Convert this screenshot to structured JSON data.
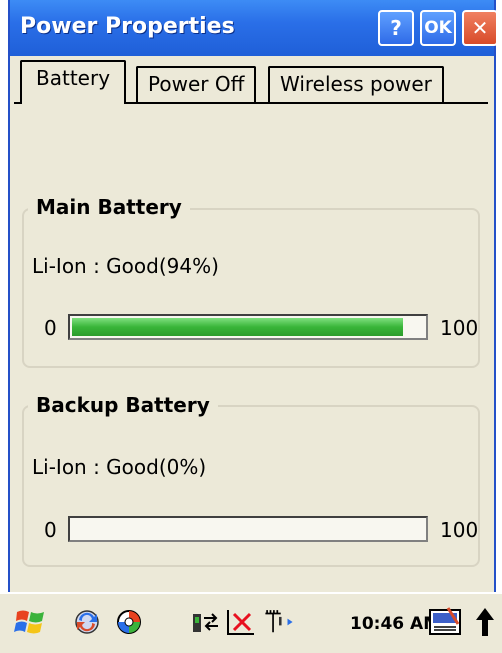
{
  "window": {
    "title": "Power Properties"
  },
  "titlebar_buttons": {
    "help": "?",
    "ok": "OK",
    "close": "✕"
  },
  "tabs": [
    {
      "label": "Battery",
      "active": true
    },
    {
      "label": "Power Off",
      "active": false
    },
    {
      "label": "Wireless power",
      "active": false
    }
  ],
  "main_battery": {
    "title": "Main Battery",
    "status": "Li-Ion : Good(94%)",
    "level_percent": 94,
    "scale_min": "0",
    "scale_max": "100"
  },
  "backup_battery": {
    "title": "Backup Battery",
    "status": "Li-Ion : Good(0%)",
    "level_percent": 0,
    "scale_min": "0",
    "scale_max": "100"
  },
  "taskbar": {
    "clock": "10:46 AM",
    "icons": [
      "start-windows-flag-icon",
      "sync-icon",
      "color-wheel-icon",
      "network-connect-icon",
      "error-x-icon",
      "signal-antenna-icon",
      "input-panel-icon",
      "up-arrow-icon"
    ]
  },
  "colors": {
    "titlebar": "#2A6FE8",
    "battery_fill": "#39B539",
    "window_bg": "#ECE9D8"
  }
}
